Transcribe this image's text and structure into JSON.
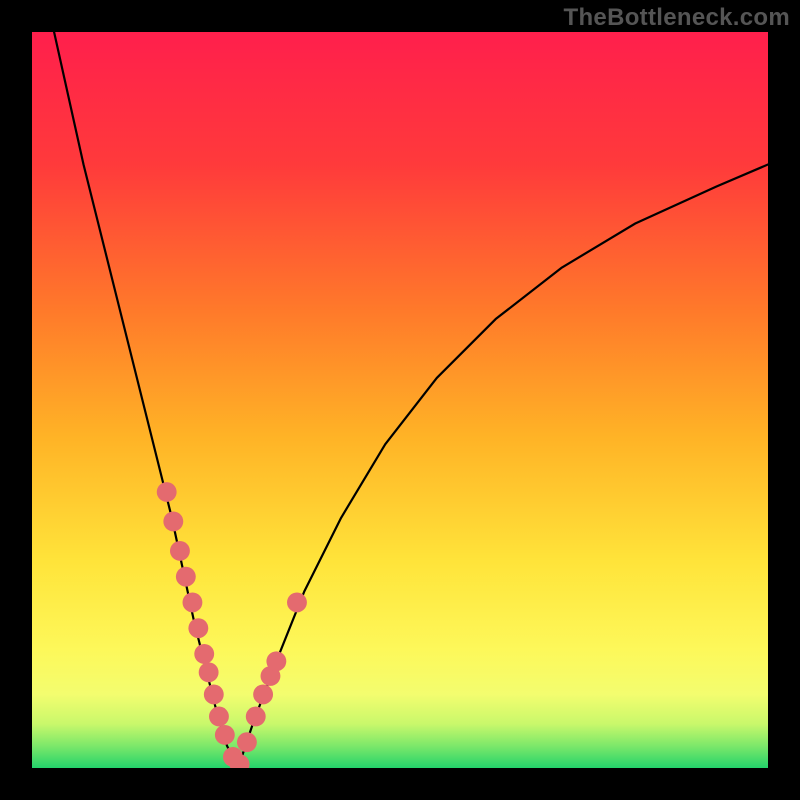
{
  "watermark": "TheBottleneck.com",
  "colors": {
    "frame": "#000000",
    "curve": "#000000",
    "dot": "#e46a6f",
    "gradient_stops": [
      {
        "offset": 0.0,
        "color": "#ff1f4c"
      },
      {
        "offset": 0.18,
        "color": "#ff3a3b"
      },
      {
        "offset": 0.38,
        "color": "#ff7a2a"
      },
      {
        "offset": 0.55,
        "color": "#ffb326"
      },
      {
        "offset": 0.72,
        "color": "#ffe43a"
      },
      {
        "offset": 0.84,
        "color": "#fdf85a"
      },
      {
        "offset": 0.9,
        "color": "#f3fd6f"
      },
      {
        "offset": 0.94,
        "color": "#c9f86b"
      },
      {
        "offset": 0.97,
        "color": "#7ce86a"
      },
      {
        "offset": 1.0,
        "color": "#24d36b"
      }
    ]
  },
  "chart_data": {
    "type": "line",
    "title": "",
    "xlabel": "",
    "ylabel": "",
    "xlim": [
      0,
      100
    ],
    "ylim": [
      0,
      100
    ],
    "grid": false,
    "legend": false,
    "series": [
      {
        "name": "left-branch",
        "x": [
          3,
          5,
          7,
          9,
          11,
          13,
          15,
          17,
          19,
          20.5,
          22,
          23.5,
          25,
          26.5,
          28
        ],
        "y": [
          100,
          91,
          82,
          74,
          66,
          58,
          50,
          42,
          34,
          27,
          20,
          14,
          8,
          3,
          0
        ]
      },
      {
        "name": "right-branch",
        "x": [
          28,
          30,
          33,
          37,
          42,
          48,
          55,
          63,
          72,
          82,
          93,
          100
        ],
        "y": [
          0,
          6,
          14,
          24,
          34,
          44,
          53,
          61,
          68,
          74,
          79,
          82
        ]
      }
    ],
    "scatter": [
      {
        "name": "left-dots",
        "x": [
          18.3,
          19.2,
          20.1,
          20.9,
          21.8,
          22.6,
          23.4,
          24.0,
          24.7,
          25.4,
          26.2,
          27.3,
          28.2
        ],
        "y": [
          37.5,
          33.5,
          29.5,
          26.0,
          22.5,
          19.0,
          15.5,
          13.0,
          10.0,
          7.0,
          4.5,
          1.5,
          0.5
        ]
      },
      {
        "name": "right-dots",
        "x": [
          29.2,
          30.4,
          31.4,
          32.4,
          33.2,
          36.0
        ],
        "y": [
          3.5,
          7.0,
          10.0,
          12.5,
          14.5,
          22.5
        ]
      }
    ],
    "annotations": [
      {
        "text": "TheBottleneck.com",
        "position": "top-right"
      }
    ]
  }
}
